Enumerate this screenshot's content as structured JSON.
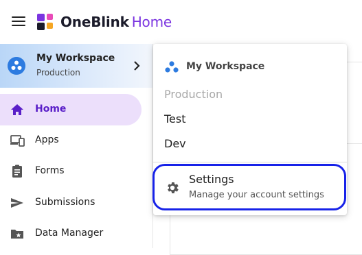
{
  "header": {
    "brand_name": "OneBlink",
    "brand_suffix": "Home"
  },
  "workspace_card": {
    "title": "My Workspace",
    "environment": "Production"
  },
  "sidebar": {
    "items": [
      {
        "label": "Home",
        "icon": "home-icon",
        "active": true
      },
      {
        "label": "Apps",
        "icon": "devices-icon",
        "active": false
      },
      {
        "label": "Forms",
        "icon": "clipboard-icon",
        "active": false
      },
      {
        "label": "Submissions",
        "icon": "send-icon",
        "active": false
      },
      {
        "label": "Data Manager",
        "icon": "folder-star-icon",
        "active": false
      }
    ]
  },
  "dropdown": {
    "header_title": "My Workspace",
    "environments": [
      {
        "label": "Production",
        "disabled": true
      },
      {
        "label": "Test",
        "disabled": false
      },
      {
        "label": "Dev",
        "disabled": false
      }
    ],
    "settings": {
      "title": "Settings",
      "subtitle": "Manage your account settings"
    }
  },
  "colors": {
    "brand_purple": "#7b35e0",
    "active_nav_bg": "#ecdffb",
    "workspace_blue": "#2d7be0",
    "focus_ring": "#1722e8"
  }
}
